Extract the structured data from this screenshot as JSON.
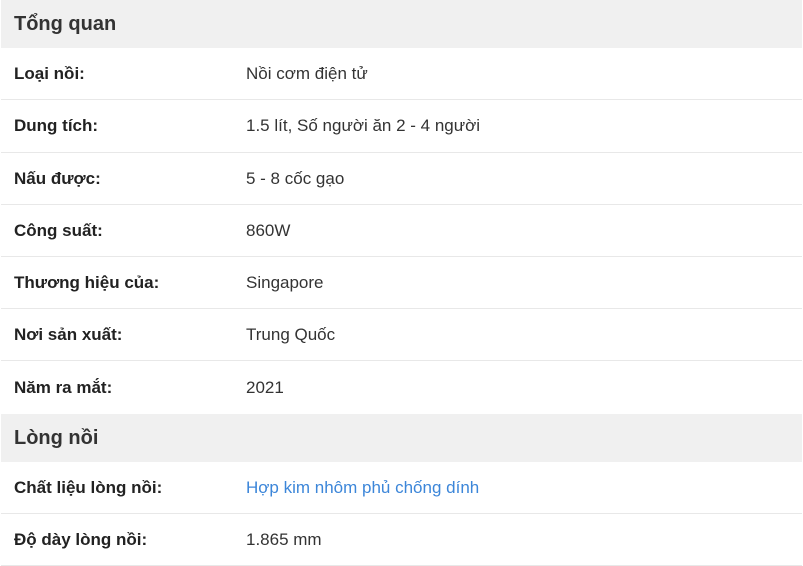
{
  "sections": [
    {
      "title": "Tổng quan",
      "rows": [
        {
          "label": "Loại nồi:",
          "value": "Nồi cơm điện tử"
        },
        {
          "label": "Dung tích:",
          "value": "1.5 lít, Số người ăn 2 - 4 người"
        },
        {
          "label": "Nấu được:",
          "value": "5 - 8 cốc gạo"
        },
        {
          "label": "Công suất:",
          "value": "860W"
        },
        {
          "label": "Thương hiệu của:",
          "value": "Singapore"
        },
        {
          "label": "Nơi sản xuất:",
          "value": "Trung Quốc"
        },
        {
          "label": "Năm ra mắt:",
          "value": "2021"
        }
      ]
    },
    {
      "title": "Lòng nồi",
      "rows": [
        {
          "label": "Chất liệu lòng nồi:",
          "value": "Hợp kim nhôm phủ chống dính"
        },
        {
          "label": "Độ dày lòng nồi:",
          "value": "1.865 mm"
        }
      ]
    }
  ],
  "colors": {
    "header_bg": "#f0f0f0",
    "link": "#3c86d9",
    "divider": "#e8e8e8"
  }
}
